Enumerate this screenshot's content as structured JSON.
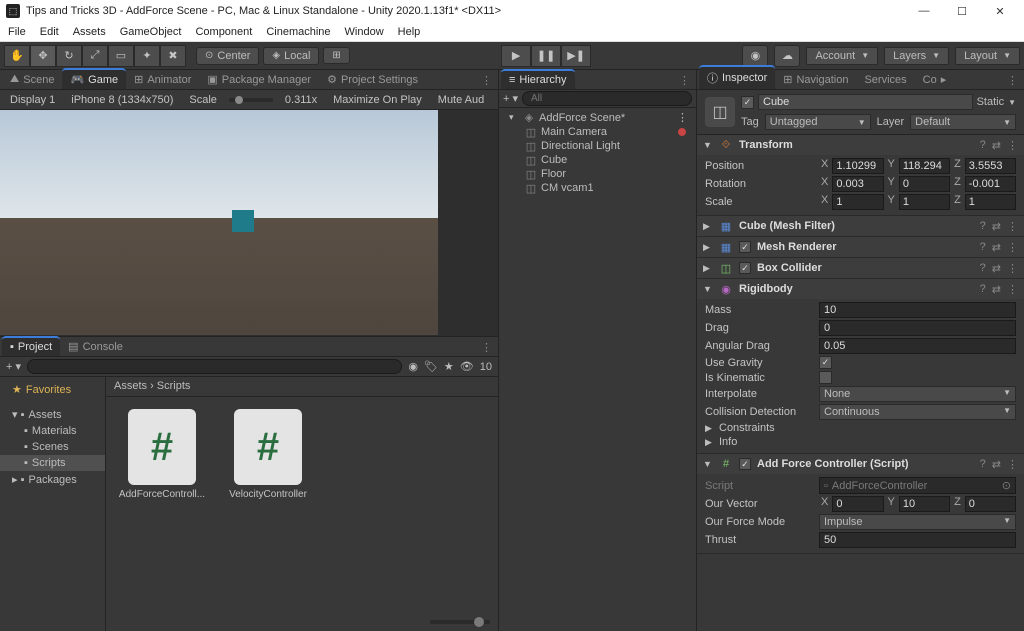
{
  "title": "Tips and Tricks 3D - AddForce Scene - PC, Mac & Linux Standalone - Unity 2020.1.13f1* <DX11>",
  "menu": [
    "File",
    "Edit",
    "Assets",
    "GameObject",
    "Component",
    "Cinemachine",
    "Window",
    "Help"
  ],
  "toolbar": {
    "center": "Center",
    "local": "Local",
    "account": "Account",
    "layers": "Layers",
    "layout": "Layout"
  },
  "scene_tabs": {
    "scene": "Scene",
    "game": "Game",
    "animator": "Animator",
    "package_manager": "Package Manager",
    "project_settings": "Project Settings"
  },
  "game_toolbar": {
    "display": "Display 1",
    "device": "iPhone 8 (1334x750)",
    "scale": "Scale",
    "scale_val": "0.311x",
    "max": "Maximize On Play",
    "mute": "Mute Aud"
  },
  "project_tabs": {
    "project": "Project",
    "console": "Console"
  },
  "project": {
    "search_placeholder": "",
    "count": "10",
    "favorites": "Favorites",
    "assets": "Assets",
    "materials": "Materials",
    "scenes": "Scenes",
    "scripts": "Scripts",
    "packages": "Packages",
    "breadcrumb": "Assets  ›  Scripts",
    "items": [
      {
        "name": "AddForceControll..."
      },
      {
        "name": "VelocityController"
      }
    ]
  },
  "hierarchy": {
    "title": "Hierarchy",
    "search_placeholder": "All",
    "scene": "AddForce Scene*",
    "items": [
      "Main Camera",
      "Directional Light",
      "Cube",
      "Floor",
      "CM vcam1"
    ]
  },
  "inspector": {
    "tabs": {
      "inspector": "Inspector",
      "navigation": "Navigation",
      "services": "Services",
      "collab": "Co"
    },
    "name": "Cube",
    "static": "Static",
    "tag_label": "Tag",
    "tag": "Untagged",
    "layer_label": "Layer",
    "layer": "Default",
    "transform": {
      "title": "Transform",
      "position": "Position",
      "px": "1.10299",
      "py": "118.294",
      "pz": "3.5553",
      "rotation": "Rotation",
      "rx": "0.003",
      "ry": "0",
      "rz": "-0.001",
      "scale": "Scale",
      "sx": "1",
      "sy": "1",
      "sz": "1"
    },
    "mesh_filter": "Cube (Mesh Filter)",
    "mesh_renderer": "Mesh Renderer",
    "box_collider": "Box Collider",
    "rigidbody": {
      "title": "Rigidbody",
      "mass": "Mass",
      "mass_v": "10",
      "drag": "Drag",
      "drag_v": "0",
      "ang": "Angular Drag",
      "ang_v": "0.05",
      "grav": "Use Gravity",
      "kin": "Is Kinematic",
      "interp": "Interpolate",
      "interp_v": "None",
      "coll": "Collision Detection",
      "coll_v": "Continuous",
      "cons": "Constraints",
      "info": "Info"
    },
    "script_comp": {
      "title": "Add Force Controller (Script)",
      "script": "Script",
      "script_v": "AddForceController",
      "vec": "Our Vector",
      "vx": "0",
      "vy": "10",
      "vz": "0",
      "mode": "Our Force Mode",
      "mode_v": "Impulse",
      "thrust": "Thrust",
      "thrust_v": "50"
    }
  }
}
